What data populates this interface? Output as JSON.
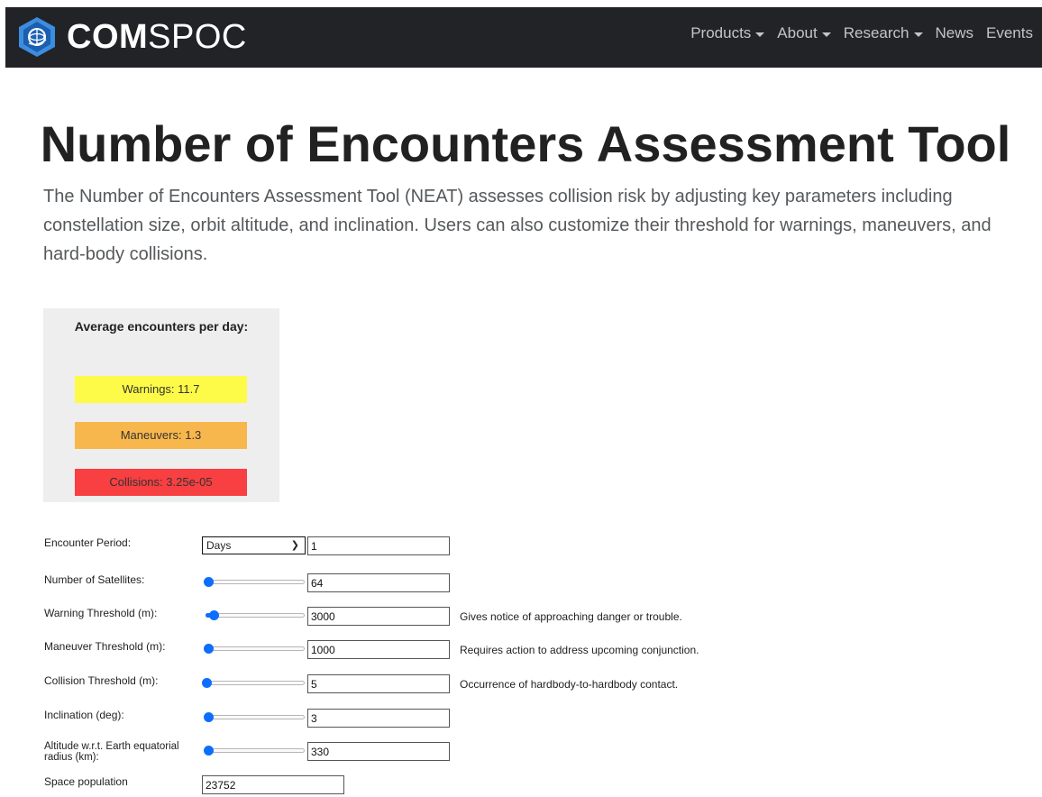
{
  "navbar": {
    "brand_bold": "COM",
    "brand_light": "SPOC",
    "items": [
      {
        "label": "Products",
        "dropdown": true
      },
      {
        "label": "About",
        "dropdown": true
      },
      {
        "label": "Research",
        "dropdown": true
      },
      {
        "label": "News",
        "dropdown": false
      },
      {
        "label": "Events",
        "dropdown": false
      }
    ]
  },
  "page": {
    "title": "Number of Encounters Assessment Tool",
    "intro": "The Number of Encounters Assessment Tool (NEAT) assesses collision risk by adjusting key parameters including constellation size, orbit altitude, and inclination. Users can also customize their threshold for warnings, maneuvers, and hard-body collisions."
  },
  "results": {
    "heading": "Average encounters per day:",
    "warnings": "Warnings: 11.7",
    "maneuvers": "Maneuvers: 1.3",
    "collisions": "Collisions: 3.25e-05",
    "colors": {
      "warnings": "#fdfb47",
      "maneuvers": "#f8b74c",
      "collisions": "#f83f41"
    }
  },
  "form": {
    "encounter_period": {
      "label": "Encounter Period:",
      "unit": "Days",
      "value": "1"
    },
    "num_satellites": {
      "label": "Number of Satellites:",
      "value": "64",
      "slider_fraction": 0.02
    },
    "warning_threshold": {
      "label": "Warning Threshold (m):",
      "value": "3000",
      "slider_fraction": 0.08,
      "hint": "Gives notice of approaching danger or trouble."
    },
    "maneuver_threshold": {
      "label": "Maneuver Threshold (m):",
      "value": "1000",
      "slider_fraction": 0.02,
      "hint": "Requires action to address upcoming conjunction."
    },
    "collision_threshold": {
      "label": "Collision Threshold (m):",
      "value": "5",
      "slider_fraction": 0.0,
      "hint": "Occurrence of hardbody-to-hardbody contact."
    },
    "inclination": {
      "label": "Inclination (deg):",
      "value": "3",
      "slider_fraction": 0.02
    },
    "altitude": {
      "label": "Altitude w.r.t. Earth equatorial radius (km):",
      "value": "330",
      "slider_fraction": 0.02
    },
    "space_population": {
      "label": "Space population",
      "value": "23752"
    }
  },
  "accent_color": "#0d6efd"
}
